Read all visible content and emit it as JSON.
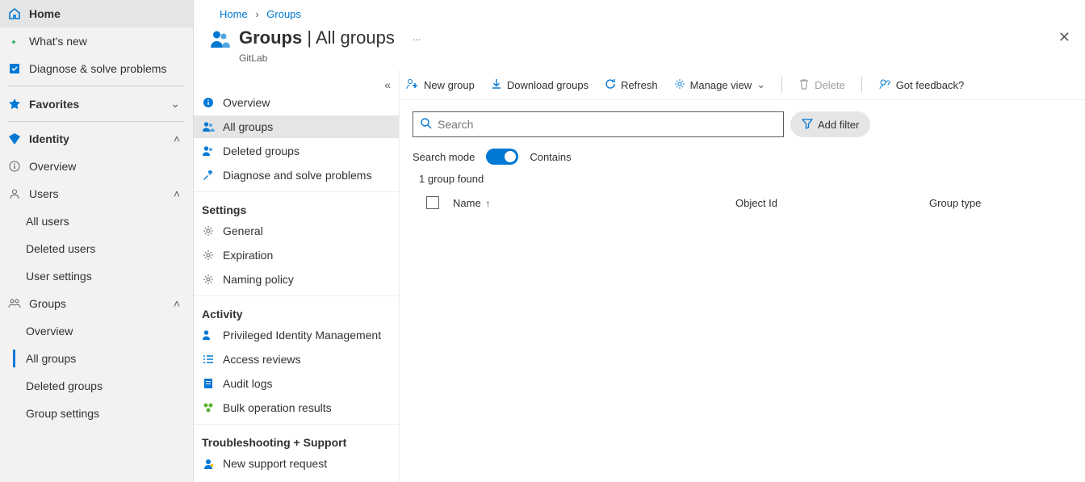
{
  "breadcrumb": {
    "home": "Home",
    "groups": "Groups"
  },
  "page": {
    "title_main": "Groups",
    "title_sub": "All groups",
    "subtitle": "GitLab"
  },
  "sidebar": {
    "home": "Home",
    "whatsnew": "What's new",
    "diagnose": "Diagnose & solve problems",
    "favorites": "Favorites",
    "identity": "Identity",
    "overview": "Overview",
    "users": "Users",
    "users_sub": {
      "all": "All users",
      "deleted": "Deleted users",
      "settings": "User settings"
    },
    "groups": "Groups",
    "groups_sub": {
      "overview": "Overview",
      "all": "All groups",
      "deleted": "Deleted groups",
      "settings": "Group settings"
    }
  },
  "mid": {
    "overview": "Overview",
    "all": "All groups",
    "deleted": "Deleted groups",
    "diag": "Diagnose and solve problems",
    "settings_h": "Settings",
    "general": "General",
    "expiration": "Expiration",
    "naming": "Naming policy",
    "activity_h": "Activity",
    "pim": "Privileged Identity Management",
    "access": "Access reviews",
    "audit": "Audit logs",
    "bulk": "Bulk operation results",
    "trouble_h": "Troubleshooting + Support",
    "support": "New support request"
  },
  "toolbar": {
    "newgroup": "New group",
    "download": "Download groups",
    "refresh": "Refresh",
    "manageview": "Manage view",
    "delete": "Delete",
    "feedback": "Got feedback?"
  },
  "search": {
    "placeholder": "Search",
    "mode_label": "Search mode",
    "mode_value": "Contains",
    "add_filter": "Add filter"
  },
  "results": {
    "count": "1 group found",
    "col_name": "Name",
    "col_objid": "Object Id",
    "col_type": "Group type"
  }
}
